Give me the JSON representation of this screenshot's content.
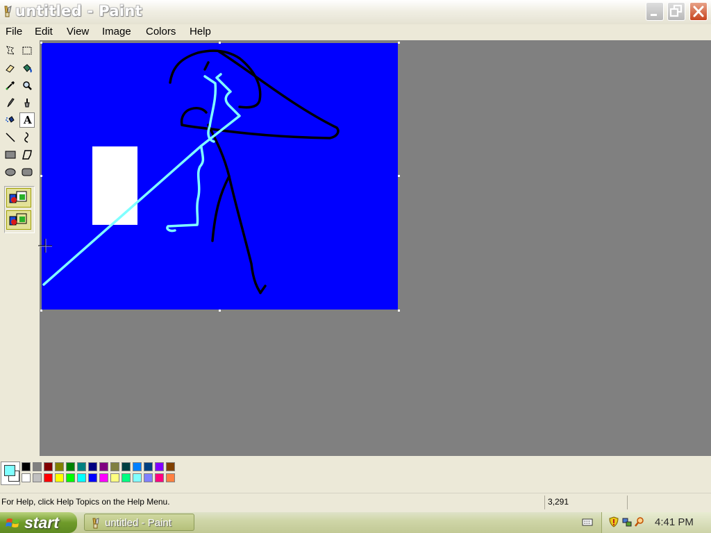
{
  "window": {
    "title": "untitled - Paint"
  },
  "menu": [
    "File",
    "Edit",
    "View",
    "Image",
    "Colors",
    "Help"
  ],
  "tools": [
    {
      "name": "free-form-select",
      "icon": "free-select-icon"
    },
    {
      "name": "select",
      "icon": "rect-select-icon"
    },
    {
      "name": "eraser",
      "icon": "eraser-icon"
    },
    {
      "name": "fill-with-color",
      "icon": "fill-bucket-icon"
    },
    {
      "name": "pick-color",
      "icon": "eyedropper-icon"
    },
    {
      "name": "magnifier",
      "icon": "magnifier-icon"
    },
    {
      "name": "pencil",
      "icon": "pencil-icon"
    },
    {
      "name": "brush",
      "icon": "brush-icon"
    },
    {
      "name": "airbrush",
      "icon": "airbrush-icon"
    },
    {
      "name": "text",
      "icon": "text-icon",
      "glyph": "A",
      "selected": true
    },
    {
      "name": "line",
      "icon": "line-icon"
    },
    {
      "name": "curve",
      "icon": "curve-icon"
    },
    {
      "name": "rectangle",
      "icon": "rectangle-icon"
    },
    {
      "name": "polygon",
      "icon": "polygon-icon"
    },
    {
      "name": "ellipse",
      "icon": "ellipse-icon"
    },
    {
      "name": "rounded-rectangle",
      "icon": "rounded-rect-icon"
    }
  ],
  "canvas": {
    "background": "#0000FF"
  },
  "colors": {
    "foreground": "#80FFFF",
    "background": "#FFFFFF",
    "palette_top": [
      "#000000",
      "#808080",
      "#800000",
      "#808000",
      "#008000",
      "#008080",
      "#000080",
      "#800080",
      "#808040",
      "#004040",
      "#0080FF",
      "#004080",
      "#8000FF",
      "#804000"
    ],
    "palette_bottom": [
      "#FFFFFF",
      "#C0C0C0",
      "#FF0000",
      "#FFFF00",
      "#00FF00",
      "#00FFFF",
      "#0000FF",
      "#FF00FF",
      "#FFFF80",
      "#00FF80",
      "#80FFFF",
      "#8080FF",
      "#FF0080",
      "#FF8040"
    ]
  },
  "status": {
    "help_text": "For Help, click Help Topics on the Help Menu.",
    "coordinates": "3,291"
  },
  "taskbar": {
    "start_label": "start",
    "task_label": "untitled - Paint",
    "clock": "4:41 PM"
  }
}
